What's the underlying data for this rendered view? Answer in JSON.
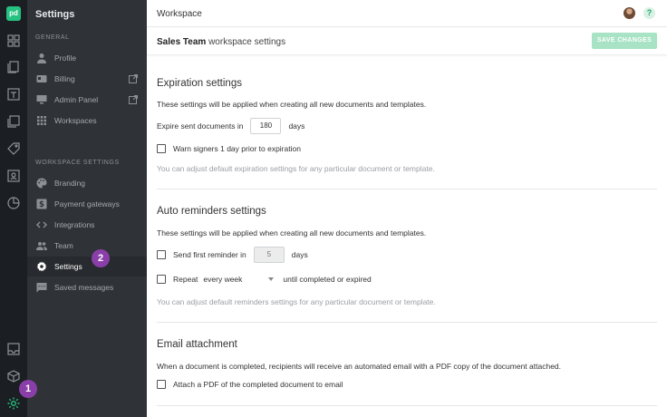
{
  "rail": {
    "logo": "pd",
    "icons": [
      "dashboard-icon",
      "documents-icon",
      "templates-icon",
      "catalog-icon",
      "tag-icon",
      "contacts-icon",
      "reports-icon",
      "inbox-icon",
      "box-icon",
      "settings-icon"
    ]
  },
  "sidebar": {
    "title": "Settings",
    "general_label": "GENERAL",
    "general_items": [
      {
        "label": "Profile",
        "icon": "person-icon"
      },
      {
        "label": "Billing",
        "icon": "billing-icon"
      },
      {
        "label": "Admin Panel",
        "icon": "monitor-icon"
      },
      {
        "label": "Workspaces",
        "icon": "grid-icon"
      }
    ],
    "workspace_label": "WORKSPACE SETTINGS",
    "workspace_items": [
      {
        "label": "Branding",
        "icon": "palette-icon"
      },
      {
        "label": "Payment gateways",
        "icon": "dollar-icon"
      },
      {
        "label": "Integrations",
        "icon": "code-icon"
      },
      {
        "label": "Team",
        "icon": "team-icon"
      },
      {
        "label": "Settings",
        "icon": "gear-icon",
        "active": true
      },
      {
        "label": "Saved messages",
        "icon": "message-icon"
      }
    ]
  },
  "badges": {
    "one": "1",
    "two": "2"
  },
  "topbar": {
    "title": "Workspace",
    "help": "?"
  },
  "subbar": {
    "workspace_name": "Sales Team",
    "suffix": " workspace settings",
    "save_label": "SAVE CHANGES"
  },
  "expiration": {
    "heading": "Expiration settings",
    "desc": "These settings will be applied when creating all new documents and templates.",
    "expire_label": "Expire sent documents in",
    "expire_value": "180",
    "days": "days",
    "warn_label": "Warn signers 1 day prior to expiration",
    "hint": "You can adjust default expiration settings for any particular document or template."
  },
  "reminders": {
    "heading": "Auto reminders settings",
    "desc": "These settings will be applied when creating all new documents and templates.",
    "first_label": "Send first reminder in",
    "first_value": "5",
    "days": "days",
    "repeat_label": "Repeat",
    "repeat_value": "every week",
    "repeat_suffix": "until completed or expired",
    "hint": "You can adjust default reminders settings for any particular document or template."
  },
  "attachment": {
    "heading": "Email attachment",
    "desc": "When a document is completed, recipients will receive an automated email with a PDF copy of the document attached.",
    "attach_label": "Attach a PDF of the completed document to email"
  },
  "colors": {
    "brand": "#26c281",
    "badge": "#8a3fa8",
    "sidebar": "#2f3338",
    "rail": "#1b1e22"
  }
}
